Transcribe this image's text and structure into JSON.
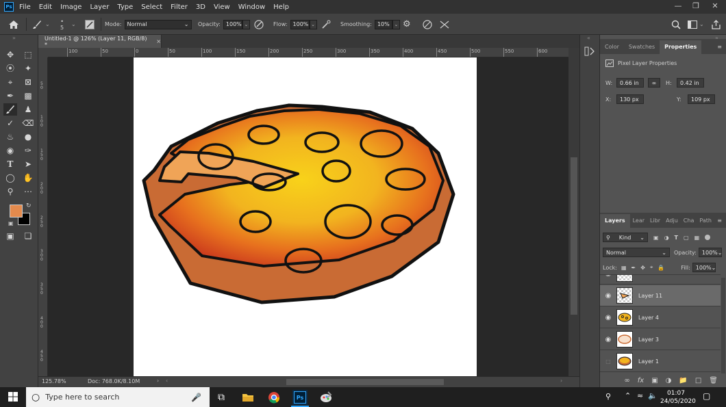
{
  "menu": {
    "logo": "Ps",
    "items": [
      "File",
      "Edit",
      "Image",
      "Layer",
      "Type",
      "Select",
      "Filter",
      "3D",
      "View",
      "Window",
      "Help"
    ]
  },
  "options": {
    "brush_size": "5",
    "mode_label": "Mode:",
    "mode_value": "Normal",
    "opacity_label": "Opacity:",
    "opacity_value": "100%",
    "flow_label": "Flow:",
    "flow_value": "100%",
    "smoothing_label": "Smoothing:",
    "smoothing_value": "10%"
  },
  "document": {
    "tab_title": "Untitled-1 @ 126% (Layer 11, RGB/8) *",
    "close": "×"
  },
  "ruler": {
    "h_labels": [
      "100",
      "50",
      "0",
      "50",
      "100",
      "150",
      "200",
      "250",
      "300",
      "350",
      "400",
      "450",
      "500",
      "550",
      "600"
    ],
    "v_labels": [
      "5\n0",
      "1\n0\n0",
      "1\n5\n0",
      "2\n0\n0",
      "2\n5\n0",
      "3\n0\n0",
      "3\n5\n0",
      "4\n0\n0",
      "4\n5\n0",
      "5\n0\n0"
    ]
  },
  "status": {
    "zoom": "125.78%",
    "doc": "Doc: 768.0K/8.10M"
  },
  "properties_panel": {
    "tabs": [
      "Color",
      "Swatches",
      "Properties"
    ],
    "active_tab": "Properties",
    "section": "Pixel Layer Properties",
    "w_label": "W:",
    "w_value": "0.66 in",
    "h_label": "H:",
    "h_value": "0.42 in",
    "x_label": "X:",
    "x_value": "130 px",
    "y_label": "Y:",
    "y_value": "109 px"
  },
  "layers_panel": {
    "tabs": [
      "Layers",
      "Lear",
      "Libr",
      "Adju",
      "Cha",
      "Path"
    ],
    "active_tab": "Layers",
    "filter": "Kind",
    "blend": "Normal",
    "opacity_label": "Opacity:",
    "opacity_value": "100%",
    "lock_label": "Lock:",
    "fill_label": "Fill:",
    "fill_value": "100%",
    "layers": [
      {
        "name": "Layer 11",
        "visible": true,
        "selected": true
      },
      {
        "name": "Layer 4",
        "visible": true,
        "selected": false
      },
      {
        "name": "Layer 3",
        "visible": true,
        "selected": false
      },
      {
        "name": "Layer 1",
        "visible": false,
        "selected": false
      }
    ]
  },
  "colors": {
    "foreground": "#e38a4d",
    "background": "#000000",
    "accent": "#31a8ff"
  },
  "taskbar": {
    "search_placeholder": "Type here to search",
    "time": "01:07",
    "date": "24/05/2020"
  }
}
